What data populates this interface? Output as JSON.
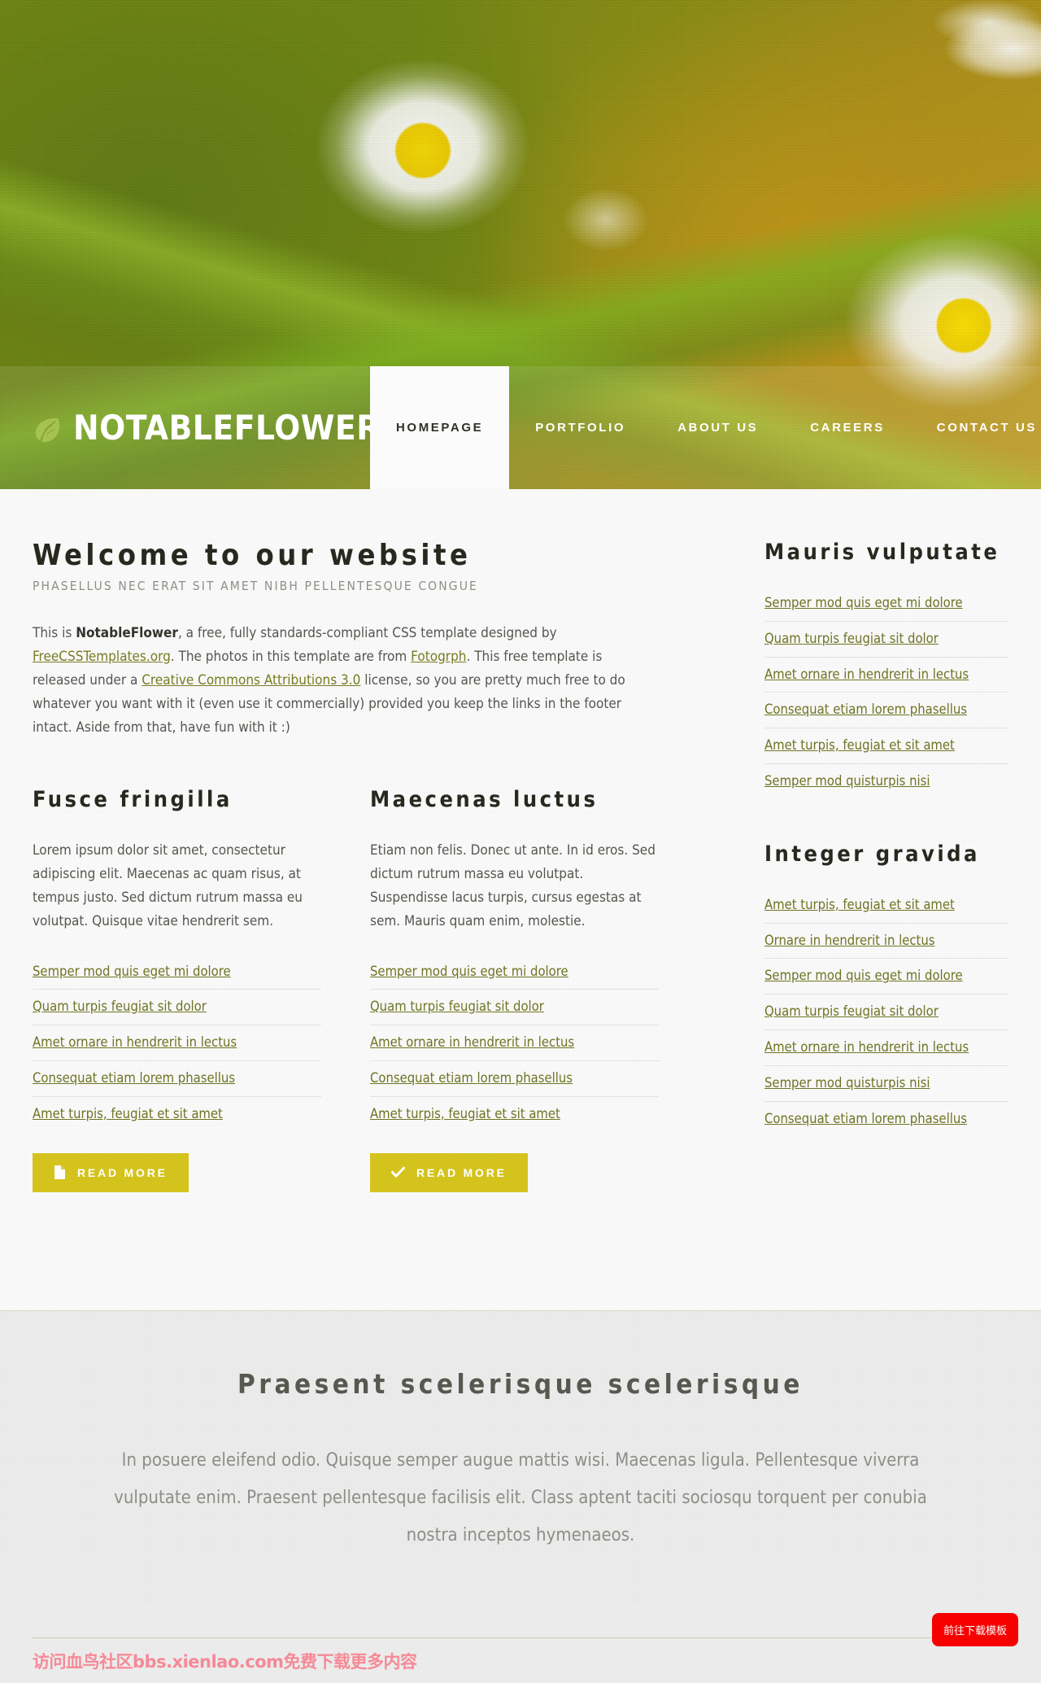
{
  "site": {
    "logo_text": "NotableFlower",
    "logo_icon": "leaf-icon"
  },
  "nav": {
    "items": [
      {
        "label": "Homepage",
        "active": true
      },
      {
        "label": "Portfolio",
        "active": false
      },
      {
        "label": "About Us",
        "active": false
      },
      {
        "label": "Careers",
        "active": false
      },
      {
        "label": "Contact Us",
        "active": false
      }
    ]
  },
  "main": {
    "title": "Welcome to our website",
    "subtitle": "Phasellus nec erat sit amet nibh pellentesque congue",
    "intro": {
      "p1": "This is ",
      "brand": "NotableFlower",
      "p2": ", a free, fully standards-compliant CSS template designed by ",
      "link1": "FreeCSSTemplates.org",
      "p3": ". The photos in this template are from ",
      "link2": "Fotogrph",
      "p4": ". This free template is released under a ",
      "link3": "Creative Commons Attributions 3.0",
      "p5": " license, so you are pretty much free to do whatever you want with it (even use it commercially) provided you keep the links in the footer intact. Aside from that, have fun with it :)"
    },
    "columns": [
      {
        "title": "Fusce fringilla",
        "body": "Lorem ipsum dolor sit amet, consectetur adipiscing elit. Maecenas ac quam risus, at tempus justo. Sed dictum rutrum massa eu volutpat. Quisque vitae hendrerit sem.",
        "links": [
          "Semper mod quis eget mi dolore",
          "Quam turpis feugiat sit dolor",
          "Amet ornare in hendrerit in lectus",
          "Consequat etiam lorem phasellus",
          "Amet turpis, feugiat et sit amet"
        ],
        "button": {
          "label": "Read More",
          "icon": "document-icon"
        }
      },
      {
        "title": "Maecenas luctus",
        "body": "Etiam non felis. Donec ut ante. In id eros. Sed dictum rutrum massa eu volutpat. Suspendisse lacus turpis, cursus egestas at sem. Mauris quam enim, molestie.",
        "links": [
          "Semper mod quis eget mi dolore",
          "Quam turpis feugiat sit dolor",
          "Amet ornare in hendrerit in lectus",
          "Consequat etiam lorem phasellus",
          "Amet turpis, feugiat et sit amet"
        ],
        "button": {
          "label": "Read More",
          "icon": "check-icon"
        }
      }
    ]
  },
  "sidebar": {
    "blocks": [
      {
        "title": "Mauris vulputate",
        "links": [
          "Semper mod quis eget mi dolore",
          "Quam turpis feugiat sit dolor",
          "Amet ornare in hendrerit in lectus",
          "Consequat etiam lorem phasellus",
          "Amet turpis, feugiat et sit amet",
          "Semper mod quisturpis nisi"
        ]
      },
      {
        "title": "Integer gravida",
        "links": [
          "Amet turpis, feugiat et sit amet",
          "Ornare in hendrerit in lectus",
          "Semper mod quis eget mi dolore",
          "Quam turpis feugiat sit dolor",
          "Amet ornare in hendrerit in lectus",
          "Semper mod quisturpis nisi",
          "Consequat etiam lorem phasellus"
        ]
      }
    ]
  },
  "feature": {
    "title": "Praesent scelerisque scelerisque",
    "body": "In posuere eleifend odio. Quisque semper augue mattis wisi. Maecenas ligula. Pellentesque viverra vulputate enim. Praesent pellentesque facilisis elit. Class aptent taciti sociosqu torquent per conubia nostra inceptos hymenaeos."
  },
  "footer": {
    "watermark": "访问血鸟社区bbs.xienlao.com免费下载更多内容",
    "download_button": "前往下载模板"
  },
  "colors": {
    "accent_yellow": "#d4c31c",
    "link_green": "#6e7424",
    "banner_green": "#6d8512",
    "watermark_pink": "#f58a97",
    "download_red": "#f60000"
  }
}
